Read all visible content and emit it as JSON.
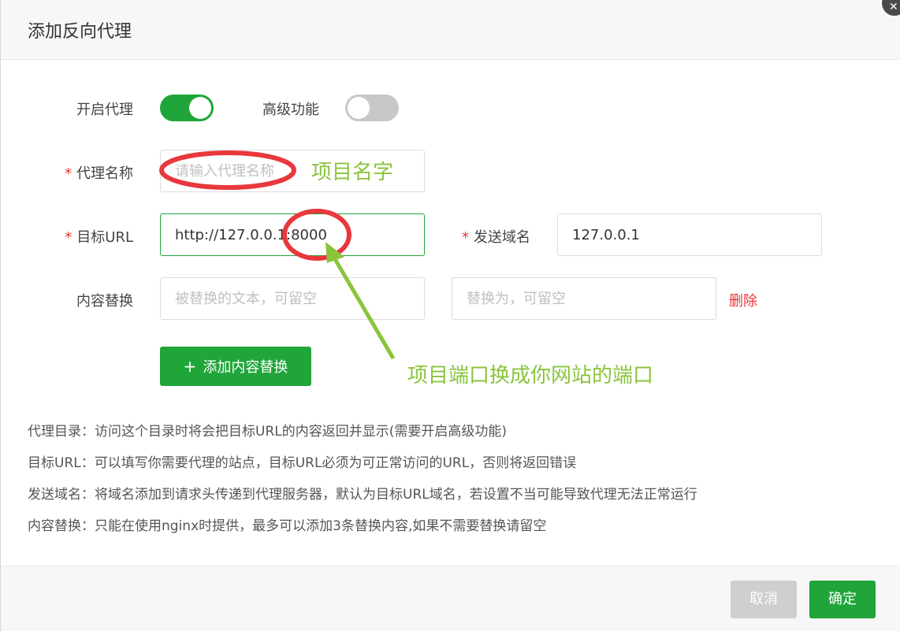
{
  "dialog": {
    "title": "添加反向代理",
    "close_icon": "close-icon"
  },
  "form": {
    "enable_proxy_label": "开启代理",
    "enable_proxy_on": true,
    "advanced_label": "高级功能",
    "advanced_on": false,
    "required_mark": "*",
    "proxy_name_label": "代理名称",
    "proxy_name_placeholder": "请输入代理名称",
    "target_url_label": "目标URL",
    "target_url_value": "http://127.0.0.1:8000",
    "send_domain_label": "发送域名",
    "send_domain_value": "127.0.0.1",
    "replace_label": "内容替换",
    "replace_from_placeholder": "被替换的文本，可留空",
    "replace_to_placeholder": "替换为，可留空",
    "delete_label": "删除",
    "add_replace_plus": "+",
    "add_replace_label": "添加内容替换"
  },
  "help": [
    "代理目录：访问这个目录时将会把目标URL的内容返回并显示(需要开启高级功能)",
    "目标URL：可以填写你需要代理的站点，目标URL必须为可正常访问的URL，否则将返回错误",
    "发送域名：将域名添加到请求头传递到代理服务器，默认为目标URL域名，若设置不当可能导致代理无法正常运行",
    "内容替换：只能在使用nginx时提供，最多可以添加3条替换内容,如果不需要替换请留空"
  ],
  "footer": {
    "cancel_label": "取消",
    "ok_label": "确定"
  },
  "annotations": {
    "name_note": "项目名字",
    "port_note": "项目端口换成你网站的端口",
    "circle_color": "#e8383d",
    "arrow_color": "#8ac43c"
  },
  "colors": {
    "accent": "#20a53a",
    "danger": "#e33333"
  }
}
